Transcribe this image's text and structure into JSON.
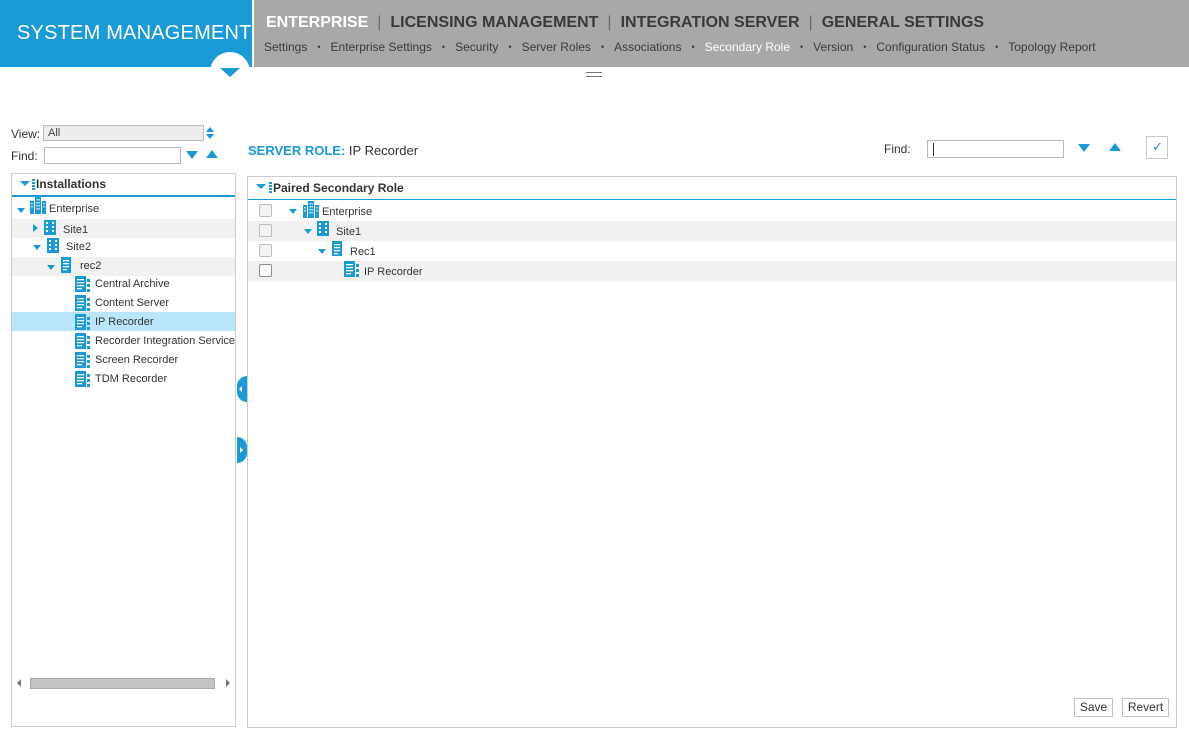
{
  "app": {
    "title": "SYSTEM MANAGEMENT",
    "main_nav": [
      {
        "label": "ENTERPRISE",
        "active": true
      },
      {
        "label": "LICENSING MANAGEMENT",
        "active": false
      },
      {
        "label": "INTEGRATION SERVER",
        "active": false
      },
      {
        "label": "GENERAL SETTINGS",
        "active": false
      }
    ],
    "main_nav_separator": "|",
    "sub_nav": [
      {
        "label": "Settings",
        "active": false
      },
      {
        "label": "Enterprise Settings",
        "active": false
      },
      {
        "label": "Security",
        "active": false
      },
      {
        "label": "Server Roles",
        "active": false
      },
      {
        "label": "Associations",
        "active": false
      },
      {
        "label": "Secondary Role",
        "active": true
      },
      {
        "label": "Version",
        "active": false
      },
      {
        "label": "Configuration Status",
        "active": false
      },
      {
        "label": "Topology Report",
        "active": false
      }
    ],
    "sub_nav_separator": "•"
  },
  "left": {
    "view_label": "View:",
    "view_value": "All",
    "find_label": "Find:",
    "find_value": "",
    "panel_title": "Installations",
    "tree": [
      {
        "label": "Enterprise",
        "icon": "enterprise-icon",
        "expanded": true
      },
      {
        "label": "Site1",
        "icon": "site-icon",
        "expanded": false
      },
      {
        "label": "Site2",
        "icon": "site-icon",
        "expanded": true
      },
      {
        "label": "rec2",
        "icon": "server-icon",
        "expanded": true
      },
      {
        "label": "Central Archive",
        "icon": "server-role-icon"
      },
      {
        "label": "Content Server",
        "icon": "server-role-icon"
      },
      {
        "label": "IP Recorder",
        "icon": "server-role-icon",
        "selected": true
      },
      {
        "label": "Recorder Integration Service",
        "icon": "server-role-icon"
      },
      {
        "label": "Screen Recorder",
        "icon": "server-role-icon"
      },
      {
        "label": "TDM Recorder",
        "icon": "server-role-icon"
      }
    ]
  },
  "right": {
    "server_role_label": "SERVER ROLE:",
    "server_role_value": "IP Recorder",
    "find_label": "Find:",
    "find_value": "",
    "panel_title": "Paired Secondary Role",
    "tree": [
      {
        "label": "Enterprise",
        "icon": "enterprise-icon",
        "expanded": true,
        "checked": false
      },
      {
        "label": "Site1",
        "icon": "site-icon",
        "expanded": true,
        "checked": false
      },
      {
        "label": "Rec1",
        "icon": "server-icon",
        "expanded": true,
        "checked": false
      },
      {
        "label": "IP Recorder",
        "icon": "server-role-icon",
        "checked": false
      }
    ],
    "save_label": "Save",
    "revert_label": "Revert"
  },
  "colors": {
    "accent": "#1a9ad6",
    "nav_background": "#a8a8a8",
    "selection": "#b9e6f8"
  }
}
